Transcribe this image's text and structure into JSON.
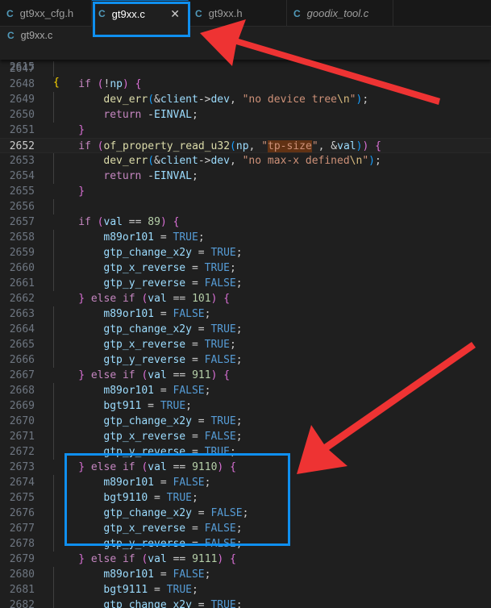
{
  "tabs": [
    {
      "label": "gt9xx_cfg.h",
      "icon": "c-file-icon",
      "icon_glyph": "C",
      "active": false,
      "italic": false
    },
    {
      "label": "gt9xx.c",
      "icon": "c-file-icon",
      "icon_glyph": "C",
      "active": true,
      "italic": false,
      "close_glyph": "✕"
    },
    {
      "label": "gt9xx.h",
      "icon": "c-file-icon",
      "icon_glyph": "C",
      "active": false,
      "italic": false
    },
    {
      "label": "goodix_tool.c",
      "icon": "c-file-icon",
      "icon_glyph": "C",
      "active": false,
      "italic": true
    }
  ],
  "breadcrumb": {
    "icon_glyph": "C",
    "file": "gt9xx.c"
  },
  "sticky_line": {
    "number": "2615",
    "tokens": [
      [
        "{",
        "br1"
      ]
    ]
  },
  "current_line": "2652",
  "code_lines": [
    {
      "n": "2647",
      "tokens": []
    },
    {
      "n": "2648",
      "tokens": [
        [
          "if",
          "kw"
        ],
        [
          " ",
          "pl"
        ],
        [
          "(",
          "br2"
        ],
        [
          "!",
          "pl"
        ],
        [
          "np",
          "var"
        ],
        [
          ")",
          "br2"
        ],
        [
          " ",
          "pl"
        ],
        [
          "{",
          "br2"
        ]
      ]
    },
    {
      "n": "2649",
      "tokens": [
        [
          "dev_err",
          "fn"
        ],
        [
          "(",
          "br3"
        ],
        [
          "&",
          "pl"
        ],
        [
          "client",
          "var"
        ],
        [
          "->",
          "pl"
        ],
        [
          "dev",
          "var"
        ],
        [
          ", ",
          "pl"
        ],
        [
          "\"no device tree",
          "str"
        ],
        [
          "\\n",
          "esc"
        ],
        [
          "\"",
          "str"
        ],
        [
          ")",
          "br3"
        ],
        [
          ";",
          "pl"
        ]
      ]
    },
    {
      "n": "2650",
      "tokens": [
        [
          "return",
          "kw"
        ],
        [
          " -",
          "pl"
        ],
        [
          "EINVAL",
          "var"
        ],
        [
          ";",
          "pl"
        ]
      ]
    },
    {
      "n": "2651",
      "tokens": [
        [
          "}",
          "br2"
        ]
      ]
    },
    {
      "n": "2652",
      "tokens": [
        [
          "if",
          "kw"
        ],
        [
          " ",
          "pl"
        ],
        [
          "(",
          "br2"
        ],
        [
          "of_property_read_u32",
          "fn"
        ],
        [
          "(",
          "br3"
        ],
        [
          "np",
          "var"
        ],
        [
          ", ",
          "pl"
        ],
        [
          "\"",
          "str"
        ],
        [
          "tp-size",
          "str",
          "hl"
        ],
        [
          "\"",
          "str"
        ],
        [
          ", ",
          "pl"
        ],
        [
          "&",
          "pl"
        ],
        [
          "val",
          "var"
        ],
        [
          ")",
          "br3"
        ],
        [
          ")",
          "br2"
        ],
        [
          " ",
          "pl"
        ],
        [
          "{",
          "br2"
        ]
      ]
    },
    {
      "n": "2653",
      "tokens": [
        [
          "dev_err",
          "fn"
        ],
        [
          "(",
          "br3"
        ],
        [
          "&",
          "pl"
        ],
        [
          "client",
          "var"
        ],
        [
          "->",
          "pl"
        ],
        [
          "dev",
          "var"
        ],
        [
          ", ",
          "pl"
        ],
        [
          "\"no max-x defined",
          "str"
        ],
        [
          "\\n",
          "esc"
        ],
        [
          "\"",
          "str"
        ],
        [
          ")",
          "br3"
        ],
        [
          ";",
          "pl"
        ]
      ]
    },
    {
      "n": "2654",
      "tokens": [
        [
          "return",
          "kw"
        ],
        [
          " -",
          "pl"
        ],
        [
          "EINVAL",
          "var"
        ],
        [
          ";",
          "pl"
        ]
      ]
    },
    {
      "n": "2655",
      "tokens": [
        [
          "}",
          "br2"
        ]
      ]
    },
    {
      "n": "2656",
      "tokens": []
    },
    {
      "n": "2657",
      "tokens": [
        [
          "if",
          "kw"
        ],
        [
          " ",
          "pl"
        ],
        [
          "(",
          "br2"
        ],
        [
          "val",
          "var"
        ],
        [
          " == ",
          "pl"
        ],
        [
          "89",
          "num"
        ],
        [
          ")",
          "br2"
        ],
        [
          " ",
          "pl"
        ],
        [
          "{",
          "br2"
        ]
      ]
    },
    {
      "n": "2658",
      "tokens": [
        [
          "m89or101",
          "var"
        ],
        [
          " = ",
          "pl"
        ],
        [
          "TRUE",
          "const"
        ],
        [
          ";",
          "pl"
        ]
      ]
    },
    {
      "n": "2659",
      "tokens": [
        [
          "gtp_change_x2y",
          "var"
        ],
        [
          " = ",
          "pl"
        ],
        [
          "TRUE",
          "const"
        ],
        [
          ";",
          "pl"
        ]
      ]
    },
    {
      "n": "2660",
      "tokens": [
        [
          "gtp_x_reverse",
          "var"
        ],
        [
          " = ",
          "pl"
        ],
        [
          "TRUE",
          "const"
        ],
        [
          ";",
          "pl"
        ]
      ]
    },
    {
      "n": "2661",
      "tokens": [
        [
          "gtp_y_reverse",
          "var"
        ],
        [
          " = ",
          "pl"
        ],
        [
          "FALSE",
          "const"
        ],
        [
          ";",
          "pl"
        ]
      ]
    },
    {
      "n": "2662",
      "tokens": [
        [
          "}",
          "br2"
        ],
        [
          " ",
          "pl"
        ],
        [
          "else",
          "kw"
        ],
        [
          " ",
          "pl"
        ],
        [
          "if",
          "kw"
        ],
        [
          " ",
          "pl"
        ],
        [
          "(",
          "br2"
        ],
        [
          "val",
          "var"
        ],
        [
          " == ",
          "pl"
        ],
        [
          "101",
          "num"
        ],
        [
          ")",
          "br2"
        ],
        [
          " ",
          "pl"
        ],
        [
          "{",
          "br2"
        ]
      ]
    },
    {
      "n": "2663",
      "tokens": [
        [
          "m89or101",
          "var"
        ],
        [
          " = ",
          "pl"
        ],
        [
          "FALSE",
          "const"
        ],
        [
          ";",
          "pl"
        ]
      ]
    },
    {
      "n": "2664",
      "tokens": [
        [
          "gtp_change_x2y",
          "var"
        ],
        [
          " = ",
          "pl"
        ],
        [
          "TRUE",
          "const"
        ],
        [
          ";",
          "pl"
        ]
      ]
    },
    {
      "n": "2665",
      "tokens": [
        [
          "gtp_x_reverse",
          "var"
        ],
        [
          " = ",
          "pl"
        ],
        [
          "TRUE",
          "const"
        ],
        [
          ";",
          "pl"
        ]
      ]
    },
    {
      "n": "2666",
      "tokens": [
        [
          "gtp_y_reverse",
          "var"
        ],
        [
          " = ",
          "pl"
        ],
        [
          "FALSE",
          "const"
        ],
        [
          ";",
          "pl"
        ]
      ]
    },
    {
      "n": "2667",
      "tokens": [
        [
          "}",
          "br2"
        ],
        [
          " ",
          "pl"
        ],
        [
          "else",
          "kw"
        ],
        [
          " ",
          "pl"
        ],
        [
          "if",
          "kw"
        ],
        [
          " ",
          "pl"
        ],
        [
          "(",
          "br2"
        ],
        [
          "val",
          "var"
        ],
        [
          " == ",
          "pl"
        ],
        [
          "911",
          "num"
        ],
        [
          ")",
          "br2"
        ],
        [
          " ",
          "pl"
        ],
        [
          "{",
          "br2"
        ]
      ]
    },
    {
      "n": "2668",
      "tokens": [
        [
          "m89or101",
          "var"
        ],
        [
          " = ",
          "pl"
        ],
        [
          "FALSE",
          "const"
        ],
        [
          ";",
          "pl"
        ]
      ]
    },
    {
      "n": "2669",
      "tokens": [
        [
          "bgt911",
          "var"
        ],
        [
          " = ",
          "pl"
        ],
        [
          "TRUE",
          "const"
        ],
        [
          ";",
          "pl"
        ]
      ]
    },
    {
      "n": "2670",
      "tokens": [
        [
          "gtp_change_x2y",
          "var"
        ],
        [
          " = ",
          "pl"
        ],
        [
          "TRUE",
          "const"
        ],
        [
          ";",
          "pl"
        ]
      ]
    },
    {
      "n": "2671",
      "tokens": [
        [
          "gtp_x_reverse",
          "var"
        ],
        [
          " = ",
          "pl"
        ],
        [
          "FALSE",
          "const"
        ],
        [
          ";",
          "pl"
        ]
      ]
    },
    {
      "n": "2672",
      "tokens": [
        [
          "gtp_y_reverse",
          "var"
        ],
        [
          " = ",
          "pl"
        ],
        [
          "TRUE",
          "const"
        ],
        [
          ";",
          "pl"
        ]
      ]
    },
    {
      "n": "2673",
      "tokens": [
        [
          "}",
          "br2"
        ],
        [
          " ",
          "pl"
        ],
        [
          "else",
          "kw"
        ],
        [
          " ",
          "pl"
        ],
        [
          "if",
          "kw"
        ],
        [
          " ",
          "pl"
        ],
        [
          "(",
          "br2"
        ],
        [
          "val",
          "var"
        ],
        [
          " == ",
          "pl"
        ],
        [
          "9110",
          "num"
        ],
        [
          ")",
          "br2"
        ],
        [
          " ",
          "pl"
        ],
        [
          "{",
          "br2"
        ]
      ]
    },
    {
      "n": "2674",
      "tokens": [
        [
          "m89or101",
          "var"
        ],
        [
          " = ",
          "pl"
        ],
        [
          "FALSE",
          "const"
        ],
        [
          ";",
          "pl"
        ]
      ]
    },
    {
      "n": "2675",
      "tokens": [
        [
          "bgt9110",
          "var"
        ],
        [
          " = ",
          "pl"
        ],
        [
          "TRUE",
          "const"
        ],
        [
          ";",
          "pl"
        ]
      ]
    },
    {
      "n": "2676",
      "tokens": [
        [
          "gtp_change_x2y",
          "var"
        ],
        [
          " = ",
          "pl"
        ],
        [
          "FALSE",
          "const"
        ],
        [
          ";",
          "pl"
        ]
      ]
    },
    {
      "n": "2677",
      "tokens": [
        [
          "gtp_x_reverse",
          "var"
        ],
        [
          " = ",
          "pl"
        ],
        [
          "FALSE",
          "const"
        ],
        [
          ";",
          "pl"
        ]
      ]
    },
    {
      "n": "2678",
      "tokens": [
        [
          "gtp_y_reverse",
          "var"
        ],
        [
          " = ",
          "pl"
        ],
        [
          "FALSE",
          "const"
        ],
        [
          ";",
          "pl"
        ]
      ]
    },
    {
      "n": "2679",
      "tokens": [
        [
          "}",
          "br2"
        ],
        [
          " ",
          "pl"
        ],
        [
          "else",
          "kw"
        ],
        [
          " ",
          "pl"
        ],
        [
          "if",
          "kw"
        ],
        [
          " ",
          "pl"
        ],
        [
          "(",
          "br2"
        ],
        [
          "val",
          "var"
        ],
        [
          " == ",
          "pl"
        ],
        [
          "9111",
          "num"
        ],
        [
          ")",
          "br2"
        ],
        [
          " ",
          "pl"
        ],
        [
          "{",
          "br2"
        ]
      ]
    },
    {
      "n": "2680",
      "tokens": [
        [
          "m89or101",
          "var"
        ],
        [
          " = ",
          "pl"
        ],
        [
          "FALSE",
          "const"
        ],
        [
          ";",
          "pl"
        ]
      ]
    },
    {
      "n": "2681",
      "tokens": [
        [
          "bgt9111",
          "var"
        ],
        [
          " = ",
          "pl"
        ],
        [
          "TRUE",
          "const"
        ],
        [
          ";",
          "pl"
        ]
      ]
    },
    {
      "n": "2682",
      "tokens": [
        [
          "gtp_change_x2y",
          "var"
        ],
        [
          " = ",
          "pl"
        ],
        [
          "TRUE",
          "const"
        ],
        [
          ";",
          "pl"
        ]
      ]
    }
  ],
  "colors": {
    "background": "#1f1f1f",
    "keyword": "#c586c0",
    "function": "#dcdcaa",
    "variable": "#9cdcfe",
    "string": "#ce9178",
    "number": "#b5cea8",
    "constant": "#569cd6",
    "search_highlight": "#613214",
    "annotation_box": "#0f8fef",
    "annotation_arrow": "#ee3333"
  }
}
